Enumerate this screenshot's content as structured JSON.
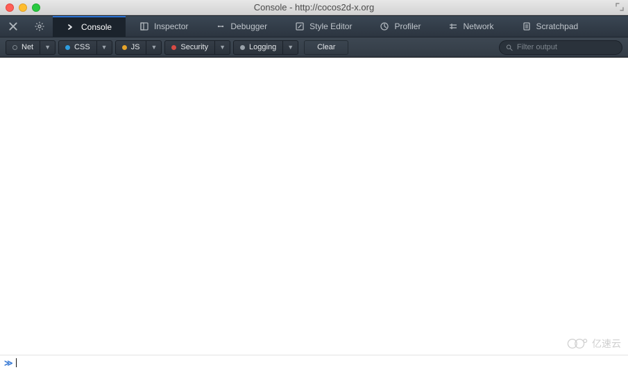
{
  "window": {
    "title": "Console - http://cocos2d-x.org"
  },
  "tabs": {
    "close_icon": "close",
    "gear_icon": "gear",
    "items": [
      {
        "label": "Console",
        "icon": "console",
        "active": true
      },
      {
        "label": "Inspector",
        "icon": "inspector",
        "active": false
      },
      {
        "label": "Debugger",
        "icon": "debugger",
        "active": false
      },
      {
        "label": "Style Editor",
        "icon": "style",
        "active": false
      },
      {
        "label": "Profiler",
        "icon": "profiler",
        "active": false
      },
      {
        "label": "Network",
        "icon": "network",
        "active": false
      },
      {
        "label": "Scratchpad",
        "icon": "scratchpad",
        "active": false
      }
    ]
  },
  "filters": {
    "net": "Net",
    "css": "CSS",
    "js": "JS",
    "security": "Security",
    "logging": "Logging",
    "clear": "Clear"
  },
  "search": {
    "placeholder": "Filter output"
  },
  "watermark": {
    "text": "亿速云"
  },
  "prompt": {
    "glyph": "≫"
  }
}
